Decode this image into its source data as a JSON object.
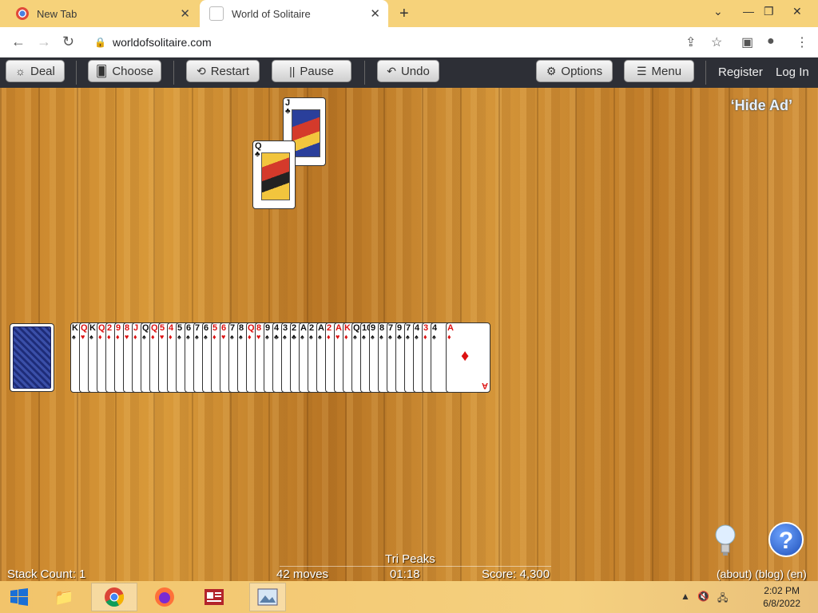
{
  "browser": {
    "tabs": [
      {
        "title": "New Tab"
      },
      {
        "title": "World of Solitaire"
      }
    ],
    "url": "worldofsolitaire.com"
  },
  "toolbar": {
    "deal": "Deal",
    "choose": "Choose",
    "restart": "Restart",
    "pause": "Pause",
    "undo": "Undo",
    "options": "Options",
    "menu": "Menu",
    "register": "Register",
    "login": "Log In"
  },
  "game": {
    "hide_ad": "‘Hide Ad’",
    "foundation_cards": [
      {
        "rank": "J",
        "suit": "♣",
        "color": "black"
      },
      {
        "rank": "Q",
        "suit": "♣",
        "color": "black"
      }
    ],
    "waste_cards": [
      {
        "rank": "K",
        "suit": "♠",
        "color": "black"
      },
      {
        "rank": "Q",
        "suit": "♥",
        "color": "red"
      },
      {
        "rank": "K",
        "suit": "♠",
        "color": "black"
      },
      {
        "rank": "Q",
        "suit": "♦",
        "color": "red"
      },
      {
        "rank": "2",
        "suit": "♦",
        "color": "red"
      },
      {
        "rank": "9",
        "suit": "♦",
        "color": "red"
      },
      {
        "rank": "8",
        "suit": "♥",
        "color": "red"
      },
      {
        "rank": "J",
        "suit": "♦",
        "color": "red"
      },
      {
        "rank": "Q",
        "suit": "♠",
        "color": "black"
      },
      {
        "rank": "Q",
        "suit": "♦",
        "color": "red"
      },
      {
        "rank": "5",
        "suit": "♥",
        "color": "red"
      },
      {
        "rank": "4",
        "suit": "♦",
        "color": "red"
      },
      {
        "rank": "5",
        "suit": "♠",
        "color": "black"
      },
      {
        "rank": "6",
        "suit": "♠",
        "color": "black"
      },
      {
        "rank": "7",
        "suit": "♠",
        "color": "black"
      },
      {
        "rank": "6",
        "suit": "♠",
        "color": "black"
      },
      {
        "rank": "5",
        "suit": "♦",
        "color": "red"
      },
      {
        "rank": "6",
        "suit": "♥",
        "color": "red"
      },
      {
        "rank": "7",
        "suit": "♠",
        "color": "black"
      },
      {
        "rank": "8",
        "suit": "♠",
        "color": "black"
      },
      {
        "rank": "Q",
        "suit": "♦",
        "color": "red"
      },
      {
        "rank": "8",
        "suit": "♥",
        "color": "red"
      },
      {
        "rank": "9",
        "suit": "♠",
        "color": "black"
      },
      {
        "rank": "4",
        "suit": "♣",
        "color": "black"
      },
      {
        "rank": "3",
        "suit": "♠",
        "color": "black"
      },
      {
        "rank": "2",
        "suit": "♣",
        "color": "black"
      },
      {
        "rank": "A",
        "suit": "♠",
        "color": "black"
      },
      {
        "rank": "2",
        "suit": "♠",
        "color": "black"
      },
      {
        "rank": "A",
        "suit": "♠",
        "color": "black"
      },
      {
        "rank": "2",
        "suit": "♦",
        "color": "red"
      },
      {
        "rank": "A",
        "suit": "♥",
        "color": "red"
      },
      {
        "rank": "K",
        "suit": "♦",
        "color": "red"
      },
      {
        "rank": "Q",
        "suit": "♠",
        "color": "black"
      },
      {
        "rank": "10",
        "suit": "♠",
        "color": "black"
      },
      {
        "rank": "9",
        "suit": "♠",
        "color": "black"
      },
      {
        "rank": "8",
        "suit": "♠",
        "color": "black"
      },
      {
        "rank": "7",
        "suit": "♠",
        "color": "black"
      },
      {
        "rank": "9",
        "suit": "♣",
        "color": "black"
      },
      {
        "rank": "7",
        "suit": "♠",
        "color": "black"
      },
      {
        "rank": "4",
        "suit": "♠",
        "color": "black"
      },
      {
        "rank": "3",
        "suit": "♦",
        "color": "red"
      },
      {
        "rank": "4",
        "suit": "♠",
        "color": "black"
      }
    ],
    "top_waste": {
      "rank": "A",
      "suit": "♦",
      "color": "red"
    }
  },
  "status": {
    "game_name": "Tri Peaks",
    "stack_count": "Stack Count: 1",
    "moves": "42 moves",
    "time": "01:18",
    "score": "Score: 4,300",
    "links": "(about) (blog) (en)"
  },
  "taskbar": {
    "time": "2:02 PM",
    "date": "6/8/2022"
  },
  "colors": {
    "toolbar": "#2d2f36",
    "tabbar": "#f6d27a"
  }
}
